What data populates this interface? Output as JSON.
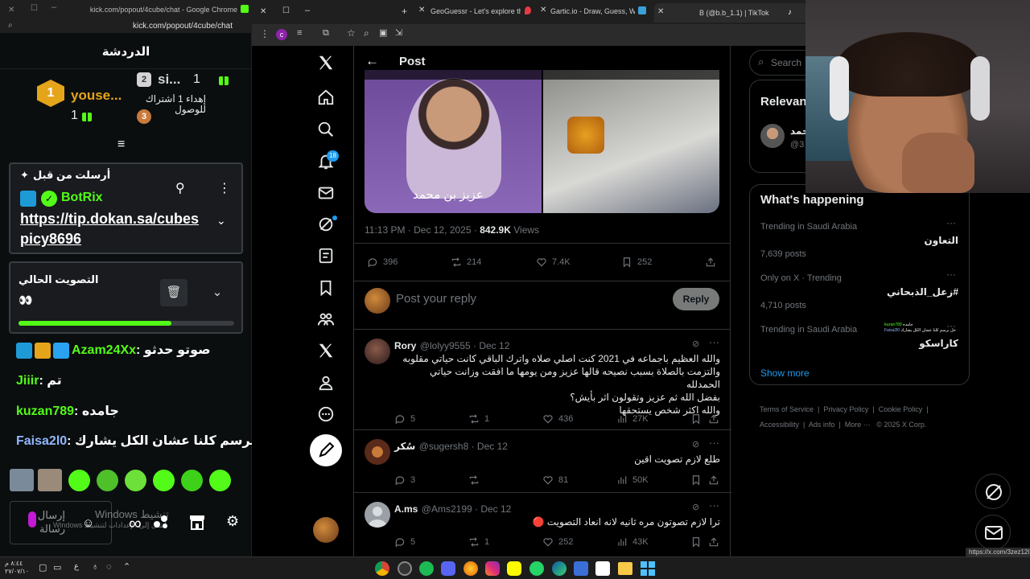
{
  "kick": {
    "window_title": "kick.com/popout/4cube/chat - Google Chrome",
    "url": "kick.com/popout/4cube/chat",
    "header_title": "الدردشة",
    "leaderboard": {
      "first_name": "youse...",
      "first_rank": "1",
      "first_count": "1",
      "second_name": "si...",
      "second_rank": "2",
      "second_count": "1",
      "third_rank": "3",
      "third_text": "إهداء 1 أشتراك للوصول"
    },
    "pinned": {
      "title": "أرسلت من قبل",
      "user": "BotRix",
      "message": "https://tip.dokan.sa/cubespicy8696"
    },
    "poll": {
      "title": "التصويت الحالي",
      "option": "👀",
      "progress": 0.71
    },
    "messages": [
      {
        "user": "Azam24Xx",
        "sep": ":",
        "text": "صوتو حدثو",
        "color": "#53fc18"
      },
      {
        "user": "Jiiir",
        "sep": ":",
        "text": "تم",
        "color": "#53fc18"
      },
      {
        "user": "kuzan789",
        "sep": ":",
        "text": "جامده",
        "color": "#53fc18"
      },
      {
        "user": "Faisa2l0",
        "sep": ":",
        "text": "خل نرسم كلنا عشان الكل يشارك",
        "color": "#8fb8ff"
      }
    ],
    "input_placeholder": "إرسال رسالة",
    "watermark_title": "Windows تنشيط",
    "watermark_sub": "Windows انتقل إلى الإعدادات لتنشيط"
  },
  "chrome": {
    "tabs": [
      {
        "label": "GeoGuessr - Let's explore the w"
      },
      {
        "label": "Gartic.io - Draw, Guess, WIN"
      },
      {
        "label": "B (@b.b_1.1) | TikTok"
      }
    ]
  },
  "x": {
    "header_title": "Post",
    "notif_count": "18",
    "image_caption": "عزيز بن محمد",
    "post_time": "11:13 PM · Dec 12, 2025 ·",
    "views_count": "842.9K",
    "views_label": "Views",
    "stats": {
      "replies": "396",
      "reposts": "214",
      "likes": "7.4K",
      "bookmarks": "252"
    },
    "reply_placeholder": "Post your reply",
    "reply_button": "Reply",
    "replies": [
      {
        "name": "Rory",
        "handle": "@lolyy9555 · Dec 12",
        "lines": [
          "والله العظيم باجماعه في 2021 كنت اصلي صلاه واترك الباقي كانت حياتي مقلوبه",
          "والتزمت بالصلاة بسبب نصيحه قالها عزيز ومن يومها ما افقت وزانت حياتي الحمدلله",
          "بفضل الله ثم عزيز وتقولون اثر بأيش؟",
          "والله اكثر شخص يستحقها"
        ],
        "replies": "5",
        "reposts": "1",
        "likes": "436",
        "views": "27K"
      },
      {
        "name": "سُكر",
        "handle": "@sugersh8 · Dec 12",
        "lines": [
          "طلع لازم تصويت اقين"
        ],
        "replies": "3",
        "reposts": "",
        "likes": "81",
        "views": "50K"
      },
      {
        "name": "A.ms",
        "handle": "@Ams2199 · Dec 12",
        "lines": [
          "ترا لازم تصوتون مره ثانيه لانه انعاد التصويت 🔴"
        ],
        "replies": "5",
        "reposts": "1",
        "likes": "252",
        "views": "43K"
      }
    ],
    "search_placeholder": "Search",
    "relevant_title": "Relevan",
    "relevant_user": "محمد",
    "relevant_handle": "@3",
    "happening_title": "What's happening",
    "trends": [
      {
        "meta": "Trending in Saudi Arabia",
        "title": "التعاون",
        "count": "7,639 posts"
      },
      {
        "meta": "Only on X · Trending",
        "title": "#زعل_الذبحاني",
        "count": "4,710 posts"
      },
      {
        "meta": "Trending in Saudi Arabia",
        "title": "كاراسكو",
        "count": ""
      }
    ],
    "overlay_chat": [
      {
        "user": "kuzan789",
        "text": "جامده"
      },
      {
        "user": "Faisa2l0",
        "text": "خل نرسم كلنا عشان الكل يشارك"
      }
    ],
    "show_more": "Show more",
    "footer": [
      "Terms of Service",
      "Privacy Policy",
      "Cookie Policy",
      "Accessibility",
      "Ads info",
      "More ···",
      "© 2025 X Corp."
    ],
    "status_url": "https://x.com/3zez12l"
  },
  "taskbar": {
    "time": "٨:٤٤ م",
    "date": "٢٧/٠٧/١٠"
  },
  "colors": {
    "kick_green": "#53fc18",
    "x_blue": "#1d9bf0",
    "gold": "#e5a51a"
  }
}
